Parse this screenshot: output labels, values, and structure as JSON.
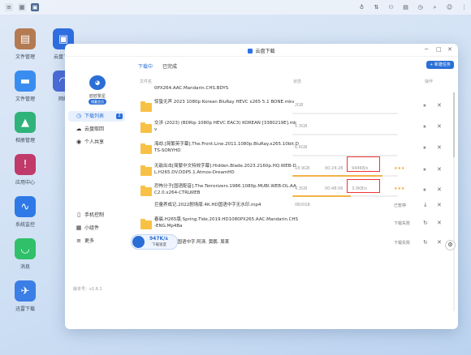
{
  "topbar": {
    "left_icons": [
      "≡",
      "▦",
      "▣"
    ],
    "right_icons": [
      "♁",
      "⇅",
      "⚇",
      "▤",
      "◷",
      "⌕",
      "☺",
      "⋮"
    ]
  },
  "desktop": [
    {
      "label": "文件管理",
      "icon": "folder-doc-icon",
      "color": "#b47a52"
    },
    {
      "label": "云盘下载",
      "icon": "tv-icon",
      "color": "#2f6ee0"
    },
    {
      "label": "文件管理",
      "icon": "folder-icon",
      "color": "#3a8df0"
    },
    {
      "label": "网络",
      "icon": "wifi-icon",
      "color": "#4a6cd8"
    },
    {
      "label": "相册管理",
      "icon": "photo-icon",
      "color": "#2fb37a"
    },
    {
      "label": "应用中心",
      "icon": "app-center-icon",
      "color": "#c03a6a"
    },
    {
      "label": "系统监控",
      "icon": "monitor-icon",
      "color": "#2f78e8"
    },
    {
      "label": "消息",
      "icon": "chat-icon",
      "color": "#30c06a"
    },
    {
      "label": "迅雷下载",
      "icon": "bird-icon",
      "color": "#3a7ee6"
    }
  ],
  "window": {
    "title": "云盘下载",
    "controls": [
      "─",
      "□",
      "✕"
    ]
  },
  "sidebar": {
    "username": "欧欧繁星",
    "vip": "储蓄会员",
    "items": [
      {
        "label": "下载列表",
        "icon": "◷",
        "count": "2"
      },
      {
        "label": "云盘取回",
        "icon": "☁"
      },
      {
        "label": "个人共享",
        "icon": "◉"
      },
      {
        "label": "手机控制",
        "icon": "▯"
      },
      {
        "label": "小组件",
        "icon": "▦"
      },
      {
        "label": "更多",
        "icon": "≡"
      }
    ],
    "version": "版本号：v1.6.1"
  },
  "tabs": [
    "下载中",
    "已完成"
  ],
  "new_task": "+ 新建任务",
  "headers": {
    "name": "文件名",
    "status": "状态",
    "op": "操作"
  },
  "rows": [
    {
      "name": "0PX264.AAC.Mandarin.CHS.BDYS",
      "size": "",
      "time": "",
      "speed": "",
      "status": "",
      "progress": 0,
      "actions": []
    },
    {
      "name": "惊蛰无声 2023 1080p Korean BluRay HEVC x265 5.1 BONE.mkv",
      "size": "2GB",
      "time": "00:00",
      "speed": "",
      "status": "等待中",
      "progress": 0,
      "actions": [
        "⏸",
        "✕"
      ]
    },
    {
      "name": "交涉 (2023) (BDRip 1080p HEVC EAC3) KOREAN [3380219E].mkv",
      "size": "5.3GB",
      "time": "00:00",
      "speed": "",
      "status": "等待中",
      "progress": 0,
      "actions": [
        "⏸",
        "✕"
      ]
    },
    {
      "name": "海劫.[简繁英字幕].The.Front.Line.2011.1080p.BluRay.x265.10bit.DTS-SONYHD",
      "size": "6.6GB",
      "time": "00:00",
      "speed": "",
      "status": "等待中",
      "progress": 0,
      "actions": [
        "⏸",
        "✕"
      ]
    },
    {
      "name": "无敌出击[简繁中文特效字幕].Hidden.Blade.2023.2160p.HQ.WEB-DL.H265.DV.DDP5.1.Atmos-DreamHD",
      "size": "18.9GB",
      "time": "00:24:28",
      "speed": "944KB/s",
      "status": "★★★",
      "progress": 0.85,
      "actions": [
        "⏸",
        "✕"
      ]
    },
    {
      "name": "恐怖分子[国语配音].The.Terrorizers.1986.1080p.MUBI.WEB-DL.AAC2.0.x264-CTRLWEB",
      "size": "4.3GB",
      "time": "00:48:06",
      "speed": "3.0KB/s",
      "status": "★★★",
      "progress": 0.55,
      "actions": [
        "⏸",
        "✕"
      ]
    },
    {
      "name": "巨量养成记.2022剧场版.4K.HD国语中字无水印.mp4",
      "size": "0B/0GB",
      "time": "",
      "speed": "",
      "status": "已暂停",
      "progress": 0,
      "actions": [
        "↓",
        "✕"
      ]
    },
    {
      "name": "春晨.H265版.Spring.Tide.2019.HD1080PX265.AAC.Mandarin.CHS-ENG.Mp4Ba",
      "size": "",
      "time": "",
      "speed": "",
      "status": "下载失败",
      "progress": 0,
      "actions": [
        "↻",
        "✕"
      ]
    },
    {
      "name": "小明.2023.国语中字.阿清. 黄鹏. 周莱",
      "size": "",
      "time": "",
      "speed": "",
      "status": "下载失败",
      "progress": 0,
      "actions": [
        "↻",
        "✕"
      ]
    }
  ],
  "speed": {
    "value": "947K/s",
    "label": "下载速度"
  },
  "fab": "⚙"
}
